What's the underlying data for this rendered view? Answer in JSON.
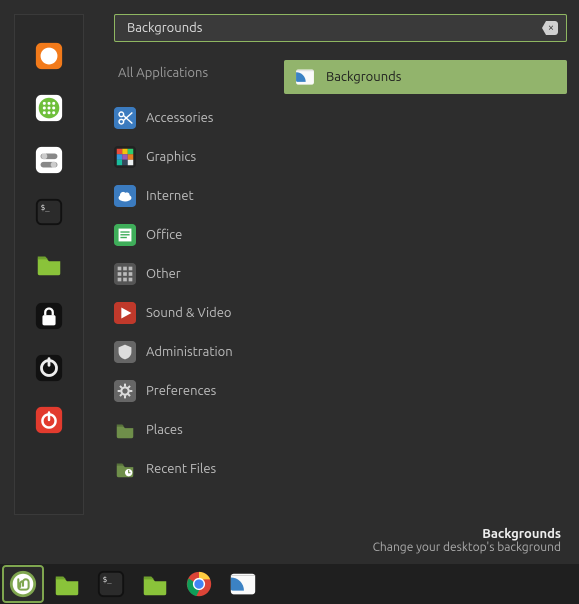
{
  "search": {
    "value": "Backgrounds"
  },
  "categories_header": "All Applications",
  "categories": [
    {
      "label": "Accessories",
      "icon": "scissors"
    },
    {
      "label": "Graphics",
      "icon": "rainbow"
    },
    {
      "label": "Internet",
      "icon": "cloud"
    },
    {
      "label": "Office",
      "icon": "office"
    },
    {
      "label": "Other",
      "icon": "grid"
    },
    {
      "label": "Sound & Video",
      "icon": "play"
    },
    {
      "label": "Administration",
      "icon": "shield"
    },
    {
      "label": "Preferences",
      "icon": "gear"
    },
    {
      "label": "Places",
      "icon": "folder"
    },
    {
      "label": "Recent Files",
      "icon": "folder-recent"
    }
  ],
  "results": [
    {
      "label": "Backgrounds",
      "icon": "wallpaper"
    }
  ],
  "status": {
    "title": "Backgrounds",
    "desc": "Change your desktop's background"
  },
  "favorites": [
    {
      "name": "firefox",
      "icon": "firefox"
    },
    {
      "name": "apps",
      "icon": "apps-grid"
    },
    {
      "name": "settings",
      "icon": "toggles"
    },
    {
      "name": "terminal",
      "icon": "terminal"
    },
    {
      "name": "files",
      "icon": "folder-green"
    },
    {
      "name": "lock",
      "icon": "lock"
    },
    {
      "name": "logout",
      "icon": "power-ring"
    },
    {
      "name": "shutdown",
      "icon": "power"
    }
  ],
  "taskbar": [
    {
      "name": "menu",
      "icon": "mint",
      "active": true
    },
    {
      "name": "files",
      "icon": "folder-green"
    },
    {
      "name": "terminal",
      "icon": "terminal"
    },
    {
      "name": "files2",
      "icon": "folder-green"
    },
    {
      "name": "chrome",
      "icon": "chrome"
    },
    {
      "name": "background",
      "icon": "wallpaper"
    }
  ]
}
